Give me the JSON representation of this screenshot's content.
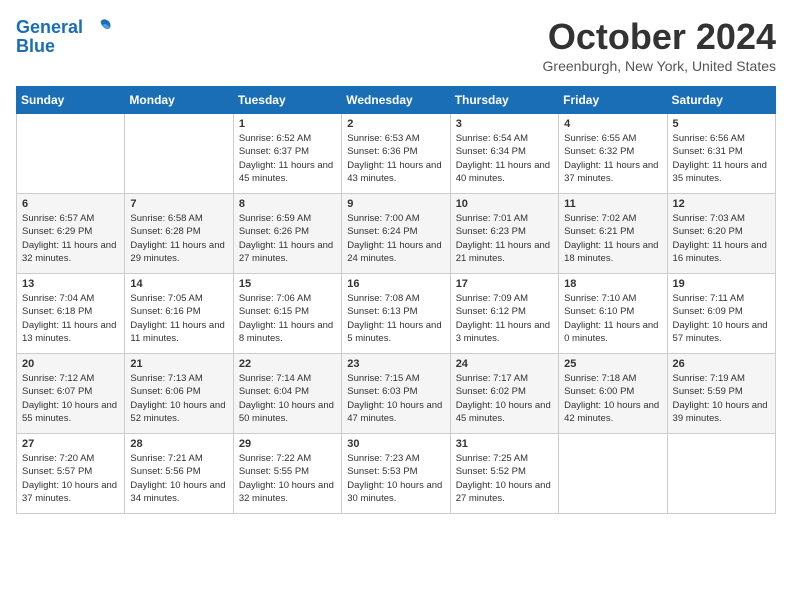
{
  "header": {
    "logo_line1": "General",
    "logo_line2": "Blue",
    "month_title": "October 2024",
    "location": "Greenburgh, New York, United States"
  },
  "days_of_week": [
    "Sunday",
    "Monday",
    "Tuesday",
    "Wednesday",
    "Thursday",
    "Friday",
    "Saturday"
  ],
  "weeks": [
    [
      {
        "day": "",
        "content": ""
      },
      {
        "day": "",
        "content": ""
      },
      {
        "day": "1",
        "content": "Sunrise: 6:52 AM\nSunset: 6:37 PM\nDaylight: 11 hours and 45 minutes."
      },
      {
        "day": "2",
        "content": "Sunrise: 6:53 AM\nSunset: 6:36 PM\nDaylight: 11 hours and 43 minutes."
      },
      {
        "day": "3",
        "content": "Sunrise: 6:54 AM\nSunset: 6:34 PM\nDaylight: 11 hours and 40 minutes."
      },
      {
        "day": "4",
        "content": "Sunrise: 6:55 AM\nSunset: 6:32 PM\nDaylight: 11 hours and 37 minutes."
      },
      {
        "day": "5",
        "content": "Sunrise: 6:56 AM\nSunset: 6:31 PM\nDaylight: 11 hours and 35 minutes."
      }
    ],
    [
      {
        "day": "6",
        "content": "Sunrise: 6:57 AM\nSunset: 6:29 PM\nDaylight: 11 hours and 32 minutes."
      },
      {
        "day": "7",
        "content": "Sunrise: 6:58 AM\nSunset: 6:28 PM\nDaylight: 11 hours and 29 minutes."
      },
      {
        "day": "8",
        "content": "Sunrise: 6:59 AM\nSunset: 6:26 PM\nDaylight: 11 hours and 27 minutes."
      },
      {
        "day": "9",
        "content": "Sunrise: 7:00 AM\nSunset: 6:24 PM\nDaylight: 11 hours and 24 minutes."
      },
      {
        "day": "10",
        "content": "Sunrise: 7:01 AM\nSunset: 6:23 PM\nDaylight: 11 hours and 21 minutes."
      },
      {
        "day": "11",
        "content": "Sunrise: 7:02 AM\nSunset: 6:21 PM\nDaylight: 11 hours and 18 minutes."
      },
      {
        "day": "12",
        "content": "Sunrise: 7:03 AM\nSunset: 6:20 PM\nDaylight: 11 hours and 16 minutes."
      }
    ],
    [
      {
        "day": "13",
        "content": "Sunrise: 7:04 AM\nSunset: 6:18 PM\nDaylight: 11 hours and 13 minutes."
      },
      {
        "day": "14",
        "content": "Sunrise: 7:05 AM\nSunset: 6:16 PM\nDaylight: 11 hours and 11 minutes."
      },
      {
        "day": "15",
        "content": "Sunrise: 7:06 AM\nSunset: 6:15 PM\nDaylight: 11 hours and 8 minutes."
      },
      {
        "day": "16",
        "content": "Sunrise: 7:08 AM\nSunset: 6:13 PM\nDaylight: 11 hours and 5 minutes."
      },
      {
        "day": "17",
        "content": "Sunrise: 7:09 AM\nSunset: 6:12 PM\nDaylight: 11 hours and 3 minutes."
      },
      {
        "day": "18",
        "content": "Sunrise: 7:10 AM\nSunset: 6:10 PM\nDaylight: 11 hours and 0 minutes."
      },
      {
        "day": "19",
        "content": "Sunrise: 7:11 AM\nSunset: 6:09 PM\nDaylight: 10 hours and 57 minutes."
      }
    ],
    [
      {
        "day": "20",
        "content": "Sunrise: 7:12 AM\nSunset: 6:07 PM\nDaylight: 10 hours and 55 minutes."
      },
      {
        "day": "21",
        "content": "Sunrise: 7:13 AM\nSunset: 6:06 PM\nDaylight: 10 hours and 52 minutes."
      },
      {
        "day": "22",
        "content": "Sunrise: 7:14 AM\nSunset: 6:04 PM\nDaylight: 10 hours and 50 minutes."
      },
      {
        "day": "23",
        "content": "Sunrise: 7:15 AM\nSunset: 6:03 PM\nDaylight: 10 hours and 47 minutes."
      },
      {
        "day": "24",
        "content": "Sunrise: 7:17 AM\nSunset: 6:02 PM\nDaylight: 10 hours and 45 minutes."
      },
      {
        "day": "25",
        "content": "Sunrise: 7:18 AM\nSunset: 6:00 PM\nDaylight: 10 hours and 42 minutes."
      },
      {
        "day": "26",
        "content": "Sunrise: 7:19 AM\nSunset: 5:59 PM\nDaylight: 10 hours and 39 minutes."
      }
    ],
    [
      {
        "day": "27",
        "content": "Sunrise: 7:20 AM\nSunset: 5:57 PM\nDaylight: 10 hours and 37 minutes."
      },
      {
        "day": "28",
        "content": "Sunrise: 7:21 AM\nSunset: 5:56 PM\nDaylight: 10 hours and 34 minutes."
      },
      {
        "day": "29",
        "content": "Sunrise: 7:22 AM\nSunset: 5:55 PM\nDaylight: 10 hours and 32 minutes."
      },
      {
        "day": "30",
        "content": "Sunrise: 7:23 AM\nSunset: 5:53 PM\nDaylight: 10 hours and 30 minutes."
      },
      {
        "day": "31",
        "content": "Sunrise: 7:25 AM\nSunset: 5:52 PM\nDaylight: 10 hours and 27 minutes."
      },
      {
        "day": "",
        "content": ""
      },
      {
        "day": "",
        "content": ""
      }
    ]
  ]
}
